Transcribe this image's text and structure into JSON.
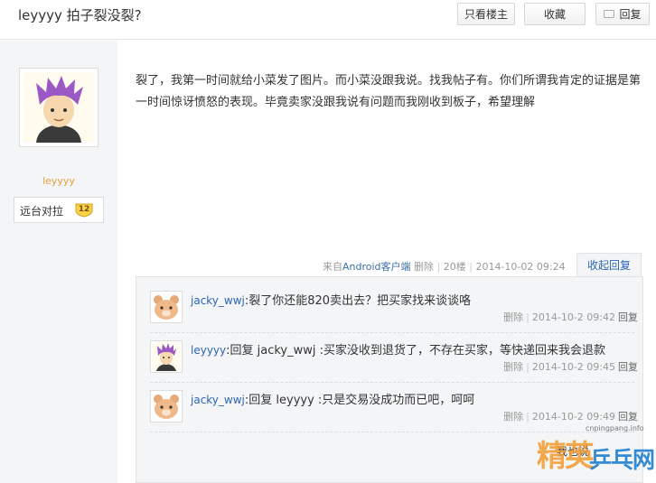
{
  "header": {
    "title": "leyyyy 拍子裂没裂?",
    "only_op_label": "只看楼主",
    "favorite_label": "收藏",
    "reply_label": "回复"
  },
  "author": {
    "username": "leyyyy",
    "fan_title": "远台对拉",
    "level": "12"
  },
  "post": {
    "content": "裂了，我第一时间就给小菜发了图片。而小菜没跟我说。找我帖子有。你们所谓我肯定的证据是第一时间惊讶愤怒的表现。毕竟卖家没跟我说有问题而我刚收到板子，希望理解",
    "source_prefix": "来自",
    "source_client": "Android客户端",
    "delete_label": "删除",
    "floor": "20楼",
    "time": "2014-10-02 09:24",
    "collapse_label": "收起回复"
  },
  "replies": [
    {
      "user": "jacky_wwj",
      "content": ":裂了你还能820卖出去？把买家找来谈谈咯",
      "delete_label": "删除",
      "time": "2014-10-2 09:42",
      "reply_label": "回复"
    },
    {
      "user": "leyyyy",
      "content": ":回复  jacky_wwj :买家没收到退货了，不存在买家，等快递回来我会退款",
      "delete_label": "删除",
      "time": "2014-10-2 09:45",
      "reply_label": "回复"
    },
    {
      "user": "jacky_wwj",
      "content": ":回复  leyyyy :只是交易没成功而已吧，呵呵",
      "delete_label": "删除",
      "time": "2014-10-2 09:49",
      "reply_label": "回复"
    }
  ],
  "watermark": {
    "url": "cnpingpang.info",
    "text1": "精英",
    "text2": "乒乓网",
    "partial": "我也说"
  },
  "colors": {
    "link": "#2d64b3",
    "username_gold": "#e2a23c",
    "panel_bg": "#f3f5f7"
  }
}
